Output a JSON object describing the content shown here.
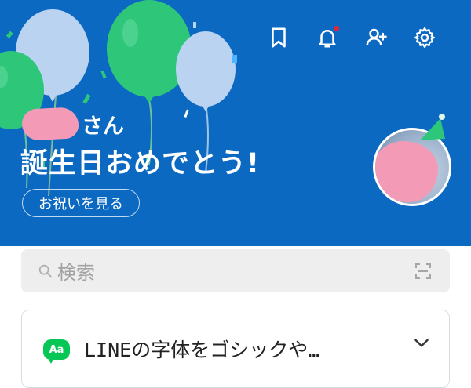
{
  "colors": {
    "banner": "#0c69c2",
    "balloon_green": "#2ec77a",
    "balloon_light": "#b9d3f0",
    "notification_dot": "#e2243a",
    "line_green": "#06c755",
    "privacy_blur": "#f39ab6"
  },
  "header": {
    "icons": [
      "bookmark-icon",
      "bell-icon",
      "add-friend-icon",
      "gear-icon"
    ]
  },
  "birthday": {
    "name_suffix": "さん",
    "greeting": "誕生日おめでとう!",
    "button_label": "お祝いを見る"
  },
  "search": {
    "placeholder": "検索"
  },
  "notice": {
    "badge": "Aa",
    "text": "LINEの字体をゴシックや…"
  }
}
